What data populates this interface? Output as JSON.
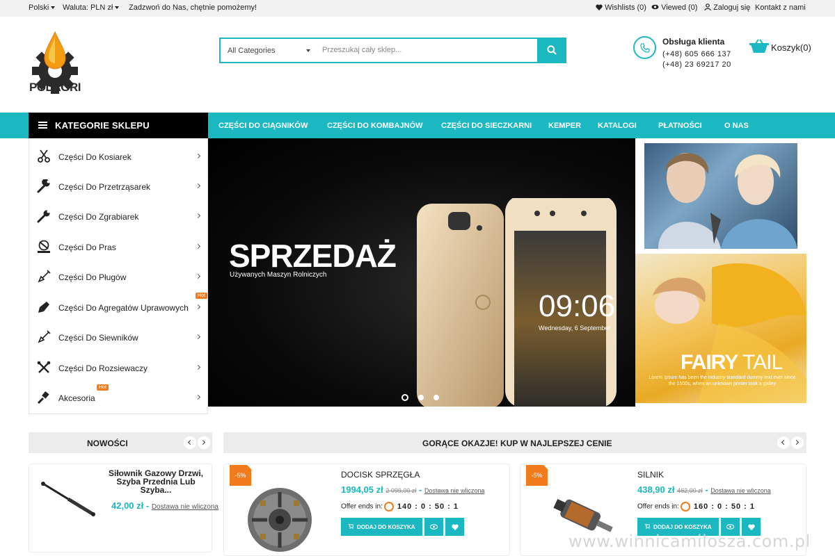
{
  "topbar": {
    "language": "Polski",
    "currency": "Waluta: PLN zł",
    "call": "Zadzwoń do Nas, chętnie pomożemy!",
    "wishlist": "Wishlists (0)",
    "viewed": "Viewed (0)",
    "login": "Zaloguj się",
    "contact": "Kontakt z nami"
  },
  "logo": {
    "text": "POLAGRI"
  },
  "search": {
    "category": "All Categories",
    "placeholder": "Przeszukaj cały sklep..."
  },
  "support": {
    "title": "Obsługa klienta",
    "phone1": "(+48) 605 666 137",
    "phone2": "(+48) 23 69217 20"
  },
  "cart": {
    "label": "Koszyk(0)"
  },
  "nav": {
    "categories_title": "KATEGORIE SKLEPU",
    "items": [
      "CZĘŚCI DO CIĄGNIKÓW",
      "CZĘŚCI DO KOMBAJNÓW",
      "CZĘŚCI DO SIECZKARNI",
      "KEMPER",
      "KATALOGI",
      "PŁATNOŚCI",
      "O NAS"
    ]
  },
  "sidebar": {
    "items": [
      {
        "label": "Części Do Kosiarek",
        "icon": "scissors-icon"
      },
      {
        "label": "Części Do Przetrząsarek",
        "icon": "wrench-icon"
      },
      {
        "label": "Części Do Zgrabiarek",
        "icon": "wrench-icon"
      },
      {
        "label": "Części Do Pras",
        "icon": "saw-icon"
      },
      {
        "label": "Części Do Pługów",
        "icon": "shovel-icon"
      },
      {
        "label": "Części Do Agregatów Uprawowych",
        "icon": "trowel-icon",
        "hot": "Hot"
      },
      {
        "label": "Części Do Siewników",
        "icon": "shovel-icon"
      },
      {
        "label": "Części Do Rozsiewaczy",
        "icon": "tools-icon"
      },
      {
        "label": "Akcesoria",
        "icon": "brush-icon",
        "hot": "Hot"
      }
    ]
  },
  "hero": {
    "title": "SPRZEDAŻ",
    "subtitle": "Używanych Maszyn Rolniczych",
    "phone_time": "09:06",
    "phone_date": "Wednesday, 6 September"
  },
  "banner2": {
    "title_a": "FAIRY",
    "title_b": "TAIL",
    "text": "Lorem Ipsum has been the industry standard dummy text ever since the 1500s, when an unknown printer took a galley"
  },
  "new_products": {
    "title": "NOWOŚCI",
    "item": {
      "name": "Siłownik Gazowy Drzwi, Szyba Przednia Lub Szyba...",
      "price": "42,00 zł",
      "shipping": "Dostawa nie wliczona"
    }
  },
  "deals": {
    "title": "GORĄCE OKAZJE! KUP W NAJLEPSZEJ CENIE",
    "items": [
      {
        "badge": "-5%",
        "name": "DOCISK SPRZĘGŁA",
        "price": "1994,05 zł",
        "old_price": "2 099,00 zł",
        "shipping": "Dostawa nie wliczona",
        "offer_label": "Offer ends in:",
        "timer": "140 : 0 : 50 : 1",
        "add_label": "DODAJ DO KOSZYKA"
      },
      {
        "badge": "-5%",
        "name": "SILNIK",
        "price": "438,90 zł",
        "old_price": "462,00 zł",
        "shipping": "Dostawa nie wliczona",
        "offer_label": "Offer ends in:",
        "timer": "160 : 0 : 50 : 1",
        "add_label": "DODAJ DO KOSZYKA"
      }
    ]
  },
  "watermark": "www.winnicamilosza.com.pl",
  "colors": {
    "accent": "#1bb8c1",
    "hot": "#f27b1c",
    "dark": "#000000"
  }
}
